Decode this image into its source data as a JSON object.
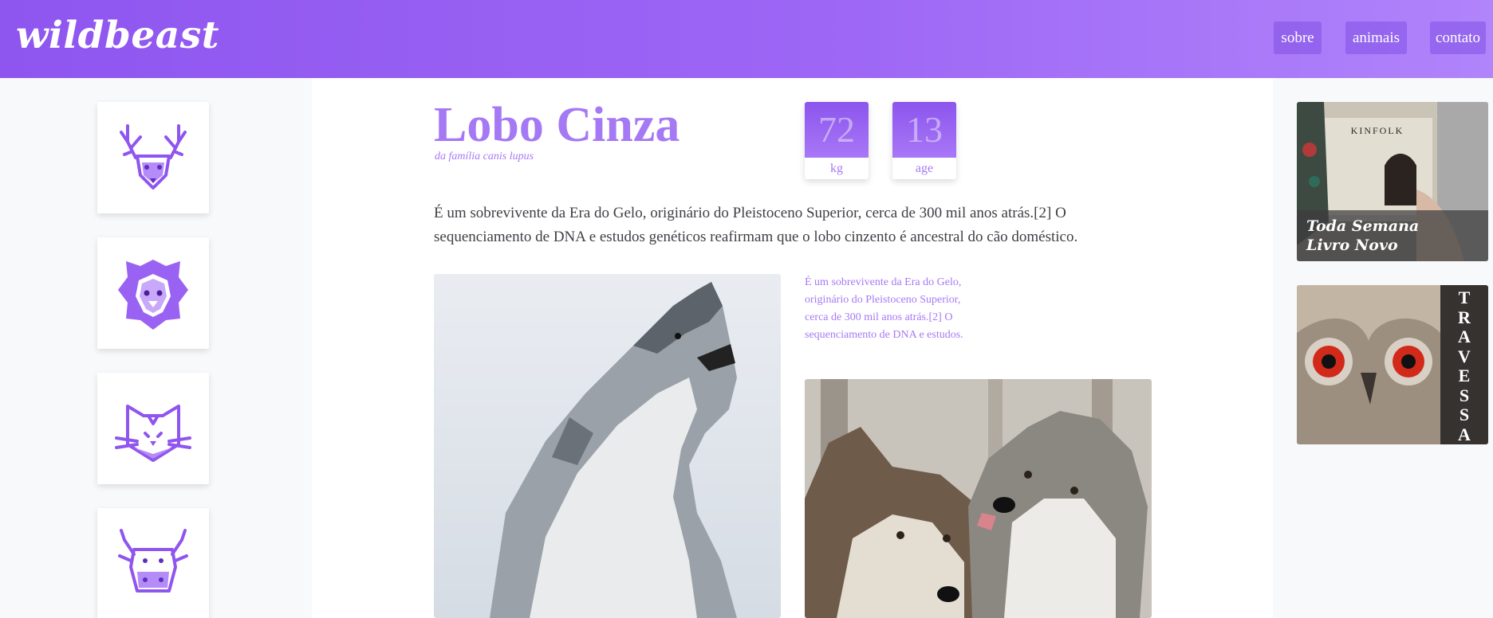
{
  "header": {
    "logo": "wildbeast",
    "nav": [
      {
        "label": "sobre"
      },
      {
        "label": "animais"
      },
      {
        "label": "contato"
      }
    ]
  },
  "sidebar": {
    "animals": [
      {
        "icon": "deer-icon"
      },
      {
        "icon": "lion-icon"
      },
      {
        "icon": "cat-icon"
      },
      {
        "icon": "bull-icon"
      }
    ]
  },
  "animal": {
    "title": "Lobo Cinza",
    "subtitle": "da família canis lupus",
    "stats": [
      {
        "value": "72",
        "label": "kg"
      },
      {
        "value": "13",
        "label": "age"
      }
    ],
    "intro": "É um sobrevivente da Era do Gelo, originário do Pleistoceno Superior, cerca de 300 mil anos atrás.[2] O sequenciamento de DNA e estudos genéticos reafirmam que o lobo cinzento é ancestral do cão doméstico.",
    "side_note": "É um sobrevivente da Era do Gelo, originário do Pleistoceno Superior, cerca de 300 mil anos atrás.[2] O sequenciamento de DNA e estudos."
  },
  "ads": {
    "book": {
      "cover_text": "KINFOLK",
      "caption_line1": "Toda Semana",
      "caption_line2": "Livro Novo"
    },
    "owl": {
      "letters": [
        "T",
        "R",
        "A",
        "V",
        "E",
        "S",
        "S",
        "A"
      ]
    }
  },
  "colors": {
    "accent": "#a679f4",
    "header_start": "#8e56ef",
    "header_end": "#b084fb",
    "text": "#3f3f46"
  }
}
